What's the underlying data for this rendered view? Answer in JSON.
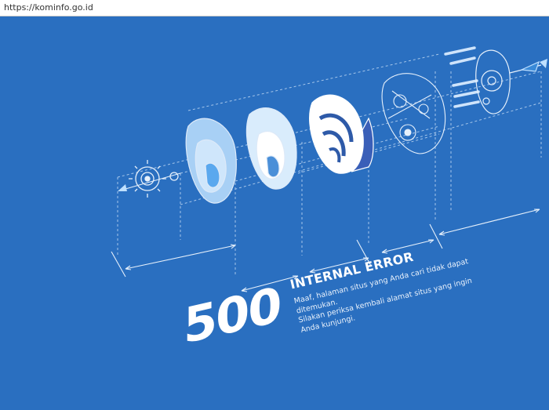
{
  "browser": {
    "url": "https://kominfo.go.id"
  },
  "error": {
    "code": "500",
    "title": "INTERNAL ERROR",
    "message_lines": [
      "Maaf, halaman situs yang Anda cari tidak dapat",
      "ditemukan.",
      "Silakan periksa kembali alamat situs yang ingin",
      "Anda kunjungi."
    ]
  },
  "colors": {
    "background": "#2a6fc0",
    "text": "#ffffff",
    "line_art": "#bcd6f2"
  }
}
